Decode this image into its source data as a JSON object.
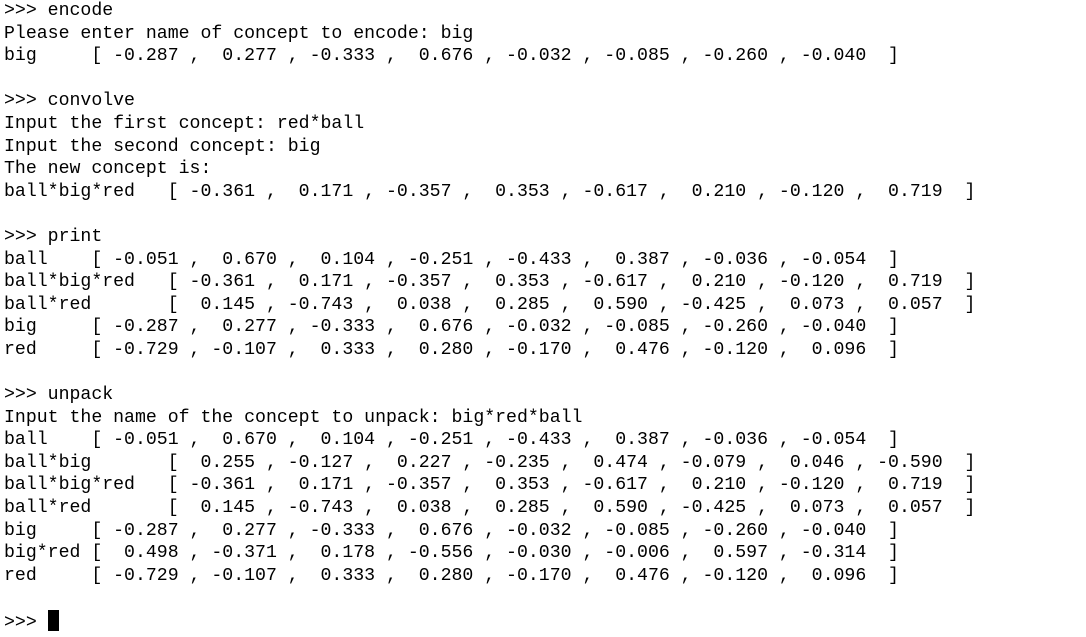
{
  "terminal": {
    "lines": [
      ">>> encode",
      "Please enter name of concept to encode: big",
      "big     [ -0.287 ,  0.277 , -0.333 ,  0.676 , -0.032 , -0.085 , -0.260 , -0.040  ]",
      "",
      ">>> convolve",
      "Input the first concept: red*ball",
      "Input the second concept: big",
      "The new concept is:",
      "ball*big*red   [ -0.361 ,  0.171 , -0.357 ,  0.353 , -0.617 ,  0.210 , -0.120 ,  0.719  ]",
      "",
      ">>> print",
      "ball    [ -0.051 ,  0.670 ,  0.104 , -0.251 , -0.433 ,  0.387 , -0.036 , -0.054  ]",
      "ball*big*red   [ -0.361 ,  0.171 , -0.357 ,  0.353 , -0.617 ,  0.210 , -0.120 ,  0.719  ]",
      "ball*red       [  0.145 , -0.743 ,  0.038 ,  0.285 ,  0.590 , -0.425 ,  0.073 ,  0.057  ]",
      "big     [ -0.287 ,  0.277 , -0.333 ,  0.676 , -0.032 , -0.085 , -0.260 , -0.040  ]",
      "red     [ -0.729 , -0.107 ,  0.333 ,  0.280 , -0.170 ,  0.476 , -0.120 ,  0.096  ]",
      "",
      ">>> unpack",
      "Input the name of the concept to unpack: big*red*ball",
      "ball    [ -0.051 ,  0.670 ,  0.104 , -0.251 , -0.433 ,  0.387 , -0.036 , -0.054  ]",
      "ball*big       [  0.255 , -0.127 ,  0.227 , -0.235 ,  0.474 , -0.079 ,  0.046 , -0.590  ]",
      "ball*big*red   [ -0.361 ,  0.171 , -0.357 ,  0.353 , -0.617 ,  0.210 , -0.120 ,  0.719  ]",
      "ball*red       [  0.145 , -0.743 ,  0.038 ,  0.285 ,  0.590 , -0.425 ,  0.073 ,  0.057  ]",
      "big     [ -0.287 ,  0.277 , -0.333 ,  0.676 , -0.032 , -0.085 , -0.260 , -0.040  ]",
      "big*red [  0.498 , -0.371 ,  0.178 , -0.556 , -0.030 , -0.006 ,  0.597 , -0.314  ]",
      "red     [ -0.729 , -0.107 ,  0.333 ,  0.280 , -0.170 ,  0.476 , -0.120 ,  0.096  ]",
      ""
    ],
    "prompt": ">>> "
  }
}
